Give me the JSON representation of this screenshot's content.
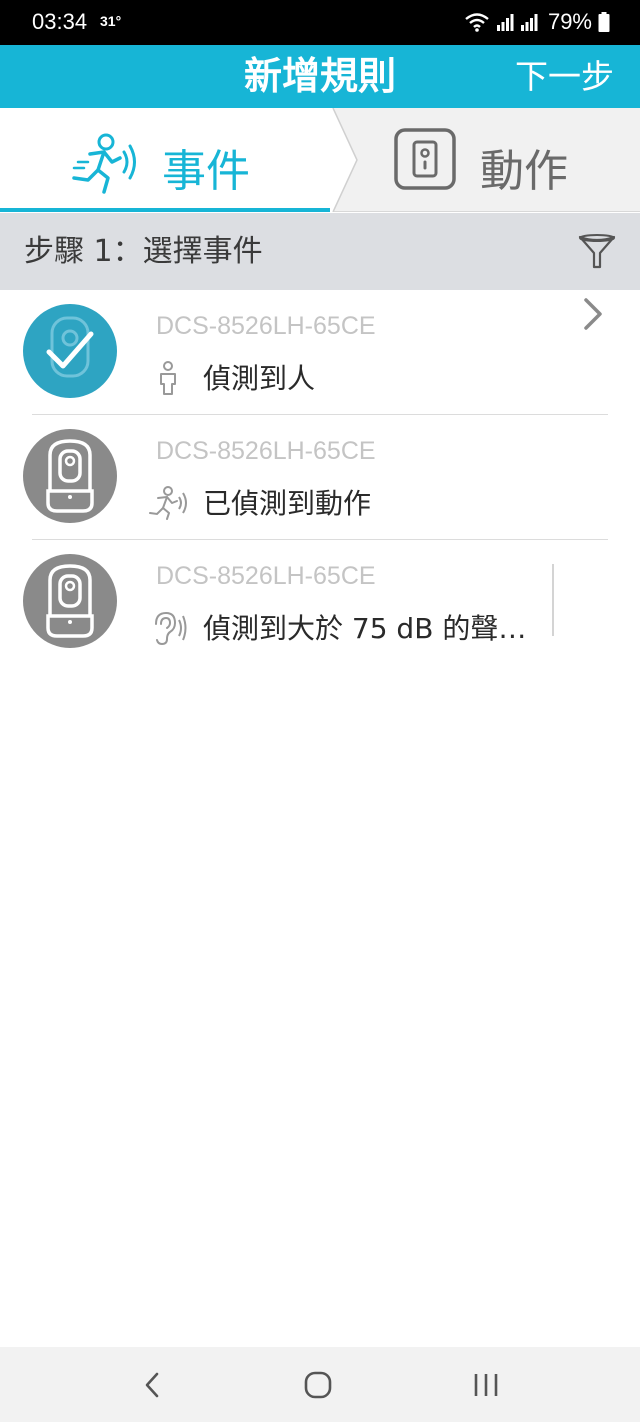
{
  "status_bar": {
    "time": "03:34",
    "temperature": "31°",
    "battery": "79%"
  },
  "header": {
    "title": "新增規則",
    "next_label": "下一步"
  },
  "tabs": [
    {
      "label": "事件",
      "icon": "running-person-icon",
      "active": true
    },
    {
      "label": "動作",
      "icon": "device-icon",
      "active": false
    }
  ],
  "step": {
    "label": "步驟 1：選擇事件",
    "filter_icon": "filter-icon"
  },
  "events": [
    {
      "device": "DCS-8526LH-65CE",
      "event": "偵測到人",
      "icon": "person-icon",
      "selected": true
    },
    {
      "device": "DCS-8526LH-65CE",
      "event": "已偵測到動作",
      "icon": "motion-icon",
      "selected": false
    },
    {
      "device": "DCS-8526LH-65CE",
      "event": "偵測到大於 75 dB 的聲…",
      "icon": "sound-icon",
      "selected": false
    }
  ],
  "nav": {
    "back_icon": "back-icon",
    "home_icon": "home-icon",
    "recents_icon": "recents-icon"
  },
  "colors": {
    "accent": "#17b5d6",
    "selected_avatar": "#2ea4c2",
    "unselected_avatar": "#8a8a8a"
  }
}
